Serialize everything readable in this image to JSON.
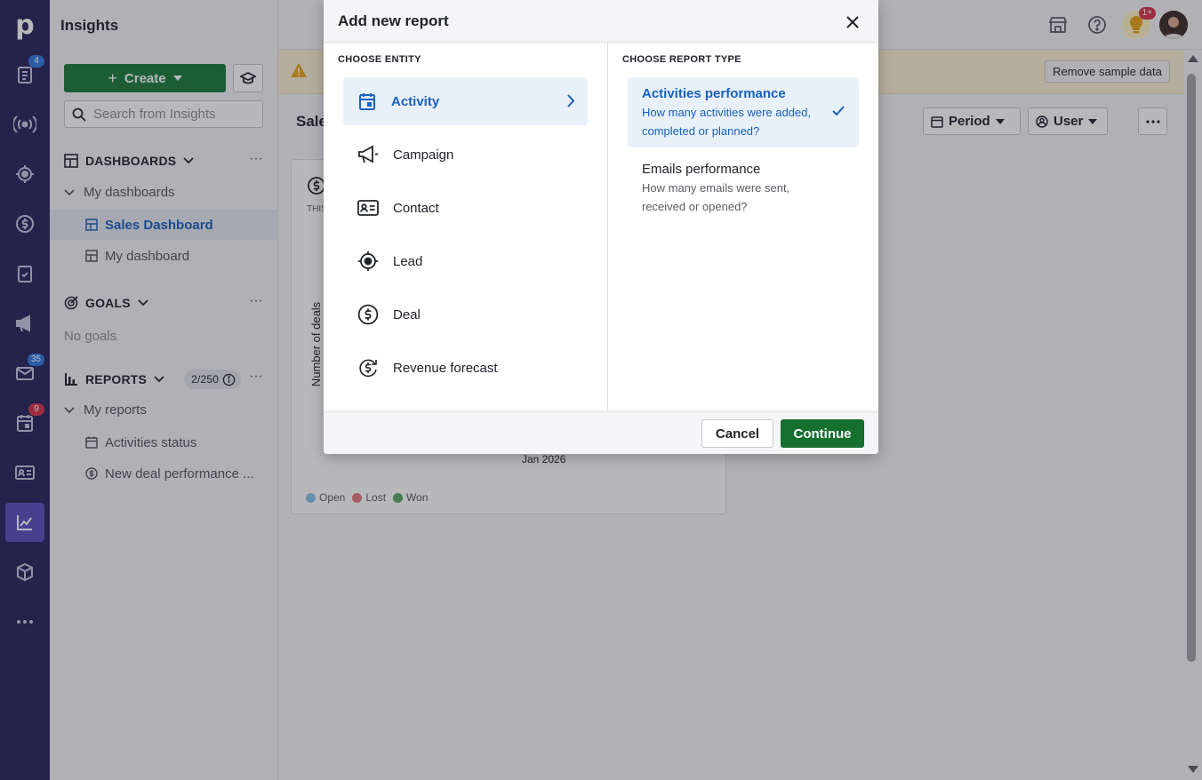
{
  "app": {
    "logo": "p",
    "title": "Insights"
  },
  "rail": {
    "items": [
      {
        "icon": "clipboard-icon",
        "badge": "4",
        "badge_color": "#317ae2"
      },
      {
        "icon": "broadcast-icon"
      },
      {
        "icon": "target-icon"
      },
      {
        "icon": "dollar-icon"
      },
      {
        "icon": "checklist-icon"
      },
      {
        "icon": "megaphone-icon"
      },
      {
        "icon": "mail-icon",
        "badge": "35",
        "badge_color": "#317ae2"
      },
      {
        "icon": "calendar-icon",
        "badge": "9",
        "badge_color": "#d6334c"
      },
      {
        "icon": "contact-card-icon"
      },
      {
        "icon": "insights-chart-icon",
        "active": true
      },
      {
        "icon": "box-icon"
      },
      {
        "icon": "more-icon"
      }
    ]
  },
  "sidebar": {
    "create_label": "Create",
    "search_placeholder": "Search from Insights",
    "dashboards": {
      "heading": "DASHBOARDS",
      "group": "My dashboards",
      "items": [
        {
          "label": "Sales Dashboard",
          "active": true
        },
        {
          "label": "My dashboard"
        }
      ]
    },
    "goals": {
      "heading": "GOALS",
      "empty": "No goals"
    },
    "reports": {
      "heading": "REPORTS",
      "count": "2/250",
      "group": "My reports",
      "items": [
        {
          "label": "Activities status",
          "icon": "calendar-icon"
        },
        {
          "label": "New deal performance ...",
          "icon": "dollar-icon"
        }
      ]
    }
  },
  "header": {
    "notification_badge": "1+"
  },
  "banner": {
    "remove_label": "Remove sample data"
  },
  "dashboard": {
    "title_partial": "Sale",
    "period_label": "Period",
    "user_label": "User",
    "card": {
      "period_partial": "THIS",
      "ylabel": "Number of deals",
      "xlabel": "Jan 2026",
      "legend": [
        {
          "label": "Open",
          "color": "#8cc3e8"
        },
        {
          "label": "Lost",
          "color": "#e27979"
        },
        {
          "label": "Won",
          "color": "#5aa86a"
        }
      ]
    }
  },
  "modal": {
    "title": "Add new report",
    "entity_heading": "CHOOSE ENTITY",
    "type_heading": "CHOOSE REPORT TYPE",
    "entities": [
      {
        "label": "Activity",
        "icon": "calendar-icon",
        "selected": true
      },
      {
        "label": "Campaign",
        "icon": "megaphone-icon"
      },
      {
        "label": "Contact",
        "icon": "contact-card-icon"
      },
      {
        "label": "Lead",
        "icon": "target-icon"
      },
      {
        "label": "Deal",
        "icon": "dollar-icon"
      },
      {
        "label": "Revenue forecast",
        "icon": "revenue-forecast-icon"
      }
    ],
    "report_types": [
      {
        "title": "Activities performance",
        "description": "How many activities were added, completed or planned?",
        "selected": true
      },
      {
        "title": "Emails performance",
        "description": "How many emails were sent, received or opened?"
      }
    ],
    "cancel_label": "Cancel",
    "continue_label": "Continue"
  },
  "colors": {
    "rail": "#27235c",
    "accent_blue": "#1961bf",
    "primary_green": "#157030",
    "warning": "#e8a317"
  }
}
